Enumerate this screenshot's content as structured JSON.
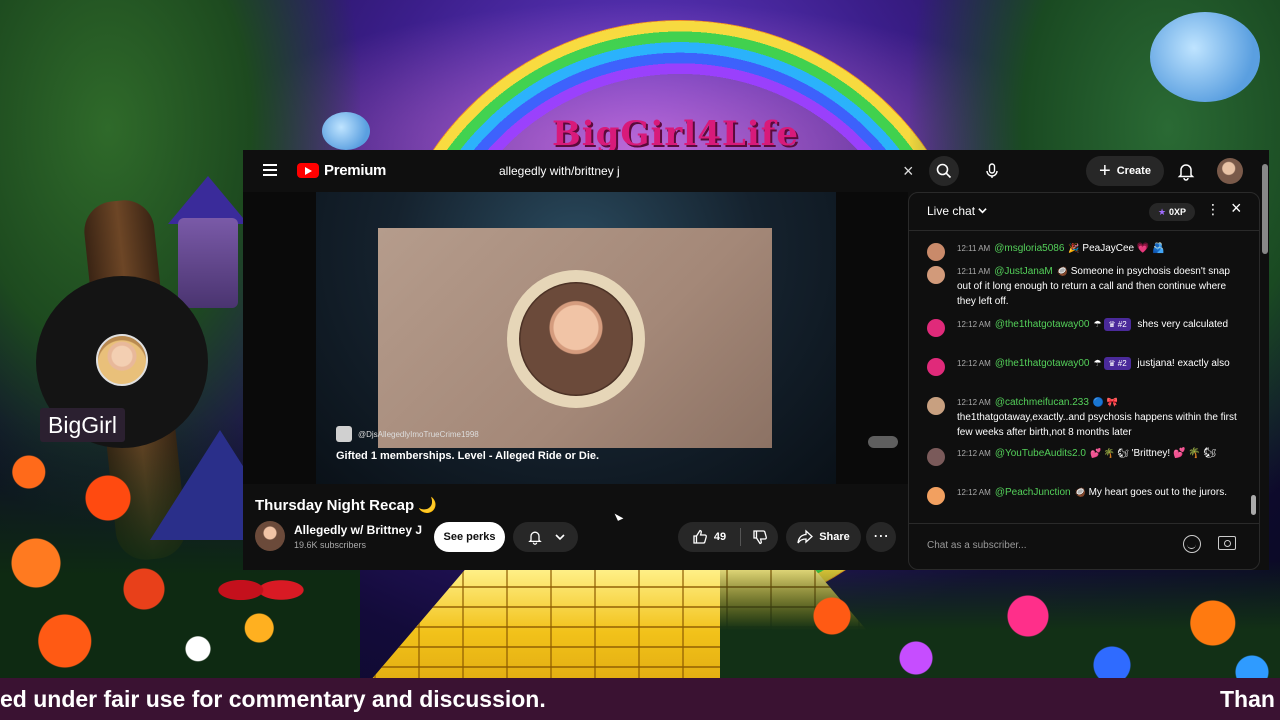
{
  "overlay": {
    "brand": "BigGirl4Life",
    "cam_label": "BigGirl",
    "ticker_left": "ed under fair use for commentary and discussion.",
    "ticker_right": "Than"
  },
  "youtube": {
    "logo": "Premium",
    "search_value": "allegedly with/brittney j",
    "create_label": "Create",
    "icons": {
      "menu": "menu-icon",
      "search": "search-icon",
      "mic": "mic-icon",
      "bell": "bell-icon"
    }
  },
  "video": {
    "handle": "@DjsAllegedlyImoTrueCrime1998",
    "caption": "Gifted 1 memberships. Level - Alleged Ride or Die.",
    "title": "Thursday Night Recap",
    "title_emoji": "🌙",
    "channel_name": "Allegedly w/ Brittney J",
    "subscribers": "19.6K subscribers",
    "perks_label": "See perks",
    "likes": "49",
    "share_label": "Share"
  },
  "chat": {
    "title": "Live chat",
    "xp": "0XP",
    "input_placeholder": "Chat as a subscriber...",
    "messages": [
      {
        "time": "12:11 AM",
        "author": "@msgloria5086",
        "badge": "",
        "emoji": "🎉",
        "text": "PeaJayCee 💗 🫂",
        "avatar": "#c98a6a"
      },
      {
        "time": "12:11 AM",
        "author": "@JustJanaM",
        "badge": "",
        "emoji": "🥥",
        "text": "Someone in psychosis doesn't snap out of it long enough to return a call and then continue where they left off.",
        "avatar": "#d29a7a"
      },
      {
        "time": "12:12 AM",
        "author": "@the1thatgotaway00",
        "badge": "♛ #2",
        "emoji": "☂",
        "text": "shes very calculated",
        "avatar": "#e02a7a"
      },
      {
        "time": "12:12 AM",
        "author": "@the1thatgotaway00",
        "badge": "♛ #2",
        "emoji": "☂",
        "text": "justjana! exactly also",
        "avatar": "#e02a7a"
      },
      {
        "time": "12:12 AM",
        "author": "@catchmeifucan.233",
        "badge": "",
        "emoji": "🔵 🎀",
        "text": "the1thatgotaway,exactly..and psychosis happens within the first few weeks after birth,not 8 months later",
        "avatar": "#c8a080"
      },
      {
        "time": "12:12 AM",
        "author": "@YouTubeAudits2.0",
        "badge": "",
        "emoji": "💕 🌴 🐿",
        "text": "'Brittney! 💕 🌴 🐿",
        "avatar": "#7a5a5a"
      },
      {
        "time": "12:12 AM",
        "author": "@PeachJunction",
        "badge": "",
        "emoji": "🥥",
        "text": "My heart goes out to the jurors.",
        "avatar": "#f2a060"
      }
    ]
  },
  "colors": {
    "yt_bg": "#0f0f0f",
    "yt_red": "#ff0000",
    "chat_author": "#54d05a",
    "ticker_bg": "#3a1232"
  }
}
